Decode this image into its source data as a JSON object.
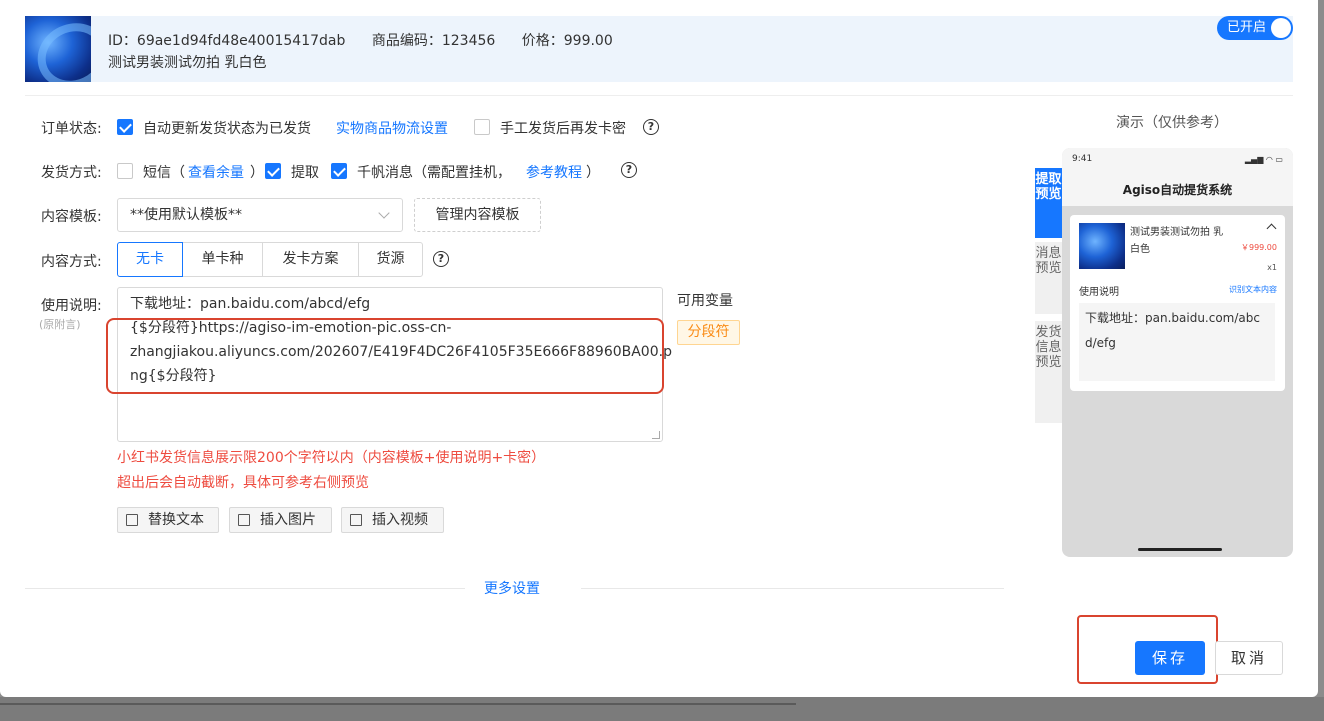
{
  "product": {
    "id_text": "ID：69ae1d94fd48e40015417dab",
    "code_text": "商品编码：123456",
    "price_text": "价格：999.00",
    "name": "测试男装测试勿拍 乳白色",
    "toggle_label": "已开启"
  },
  "form": {
    "order_status": {
      "label": "订单状态:",
      "auto_update_label": "自动更新发货状态为已发货",
      "auto_update_checked": true,
      "logistics_link": "实物商品物流设置",
      "manual_label": "手工发货后再发卡密",
      "manual_checked": false
    },
    "ship_method": {
      "label": "发货方式:",
      "sms_label": "短信（",
      "sms_link": "查看余量",
      "sms_close": "）",
      "sms_checked": false,
      "pickup_label": "提取",
      "pickup_checked": true,
      "qianfan_label": "千帆消息（需配置挂机，",
      "qianfan_link": "参考教程",
      "qianfan_close": "）",
      "qianfan_checked": true
    },
    "template": {
      "label": "内容模板:",
      "selected": "**使用默认模板**",
      "manage_button": "管理内容模板"
    },
    "content_mode": {
      "label": "内容方式:",
      "options": [
        "无卡",
        "单卡种",
        "发卡方案",
        "货源"
      ],
      "selected": "无卡"
    },
    "instructions": {
      "label": "使用说明:",
      "sublabel": "(原附言)",
      "lines": [
        "下载地址：pan.baidu.com/abcd/efg",
        "{$分段符}https://agiso-im-emotion-pic.oss-cn-",
        "zhangjiakou.aliyuncs.com/202607/E419F4DC26F4105F35E666F88960BA00.p",
        "ng{$分段符}"
      ],
      "vars_title": "可用变量",
      "var_tag": "分段符",
      "warning_1": "小红书发货信息展示限200个字符以内（内容模板+使用说明+卡密）",
      "warning_2": "超出后会自动截断，具体可参考右侧预览"
    },
    "toolbar": {
      "replace_text": "替换文本",
      "insert_image": "插入图片",
      "insert_video": "插入视频"
    },
    "more_settings": "更多设置"
  },
  "preview": {
    "title": "演示（仅供参考）",
    "tabs": [
      "提取预览",
      "消息预览",
      "发货信息预览"
    ],
    "active_tab": "提取预览",
    "phone": {
      "time": "9:41",
      "app_title": "Agiso自动提货系统",
      "product_name": "测试男装测试勿拍 乳白色",
      "price": "￥999.00",
      "qty": "x1",
      "instructions_label": "使用说明",
      "recognize_link": "识别文本内容",
      "content": "下载地址：pan.baidu.com/abcd/efg"
    }
  },
  "footer": {
    "save": "保存",
    "cancel": "取消"
  },
  "colors": {
    "accent": "#1677ff",
    "warning": "#ee4c40",
    "highlight_box": "#d9442f",
    "tag_bg": "#fff7e6",
    "tag_text": "#fa8c16"
  }
}
